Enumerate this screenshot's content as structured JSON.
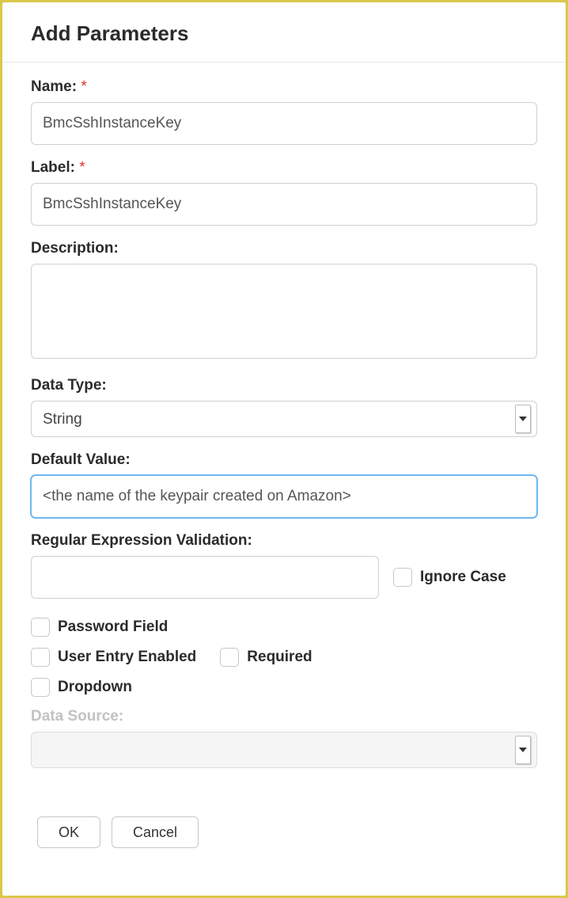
{
  "dialog": {
    "title": "Add Parameters"
  },
  "fields": {
    "name": {
      "label": "Name:",
      "value": "BmcSshInstanceKey",
      "required": true
    },
    "label_field": {
      "label": "Label:",
      "value": "BmcSshInstanceKey",
      "required": true
    },
    "description": {
      "label": "Description:",
      "value": ""
    },
    "data_type": {
      "label": "Data Type:",
      "value": "String"
    },
    "default_value": {
      "label": "Default Value:",
      "value": "<the name of the keypair created on Amazon>"
    },
    "regex": {
      "label": "Regular Expression Validation:",
      "value": ""
    },
    "data_source": {
      "label": "Data Source:",
      "value": ""
    }
  },
  "checkboxes": {
    "ignore_case": "Ignore Case",
    "password_field": "Password Field",
    "user_entry_enabled": "User Entry Enabled",
    "required": "Required",
    "dropdown": "Dropdown"
  },
  "buttons": {
    "ok": "OK",
    "cancel": "Cancel"
  },
  "required_marker": "*"
}
